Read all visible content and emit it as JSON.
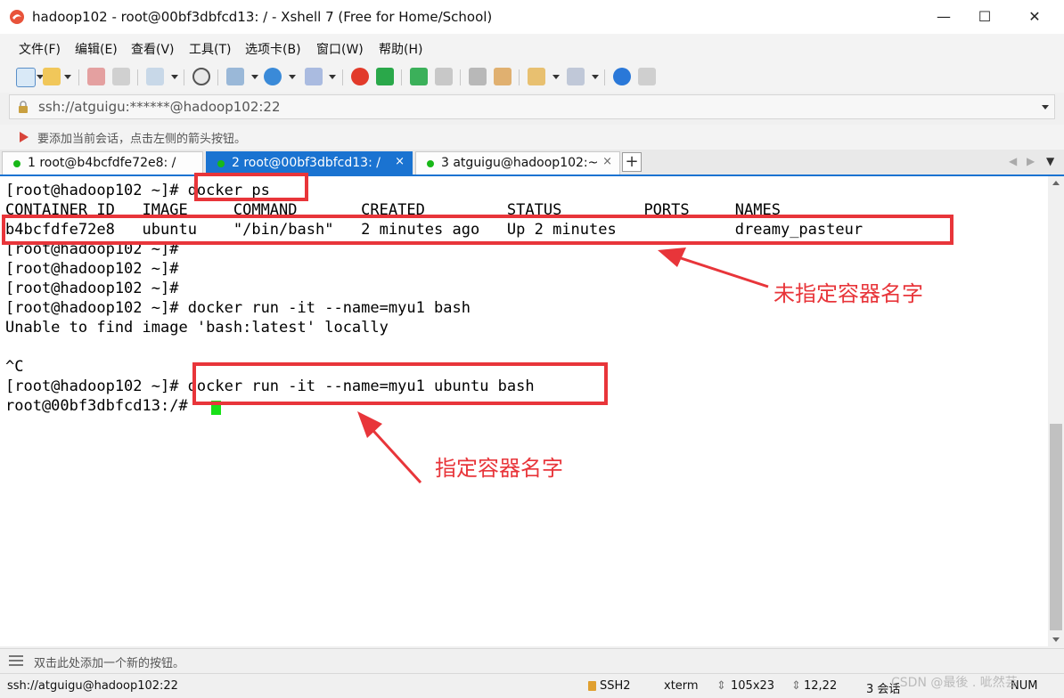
{
  "window": {
    "title": "hadoop102 - root@00bf3dbfcd13: / - Xshell 7 (Free for Home/School)",
    "minimize": "—",
    "maximize": "☐",
    "close": "✕"
  },
  "menu": {
    "items": [
      "文件(F)",
      "编辑(E)",
      "查看(V)",
      "工具(T)",
      "选项卡(B)",
      "窗口(W)",
      "帮助(H)"
    ]
  },
  "address": {
    "value": "ssh://atguigu:******@hadoop102:22"
  },
  "hint": {
    "text": "要添加当前会话，点击左侧的箭头按钮。"
  },
  "tabs": [
    {
      "label": "1 root@b4bcfdfe72e8: /",
      "active": false
    },
    {
      "label": "2 root@00bf3dbfcd13: /",
      "active": true
    },
    {
      "label": "3 atguigu@hadoop102:~",
      "active": false
    }
  ],
  "tab_close": "×",
  "tab_add": "+",
  "tab_nav": {
    "left": "◀",
    "right": "▶",
    "menu": "▼"
  },
  "terminal": {
    "lines": [
      "[root@hadoop102 ~]# docker ps",
      "CONTAINER ID   IMAGE     COMMAND       CREATED         STATUS         PORTS     NAMES",
      "b4bcfdfe72e8   ubuntu    \"/bin/bash\"   2 minutes ago   Up 2 minutes             dreamy_pasteur",
      "[root@hadoop102 ~]#",
      "[root@hadoop102 ~]#",
      "[root@hadoop102 ~]#",
      "[root@hadoop102 ~]# docker run -it --name=myu1 bash",
      "Unable to find image 'bash:latest' locally",
      "",
      "^C",
      "[root@hadoop102 ~]# docker run -it --name=myu1 ubuntu bash",
      "root@00bf3dbfcd13:/#"
    ]
  },
  "annotations": {
    "unnamed": "未指定容器名字",
    "named": "指定容器名字"
  },
  "quickbar": {
    "text": "双击此处添加一个新的按钮。"
  },
  "status": {
    "connection": "ssh://atguigu@hadoop102:22",
    "protocol": "SSH2",
    "term": "xterm",
    "size": "105x23",
    "cursor_pos": "12,22",
    "sessions": "3 会话",
    "num": "NUM"
  },
  "watermark": "CSDN @最後 . 呲然芸",
  "colors": {
    "accent": "#1a73d1",
    "annotation_red": "#e8353a",
    "cursor_green": "#18e018"
  }
}
